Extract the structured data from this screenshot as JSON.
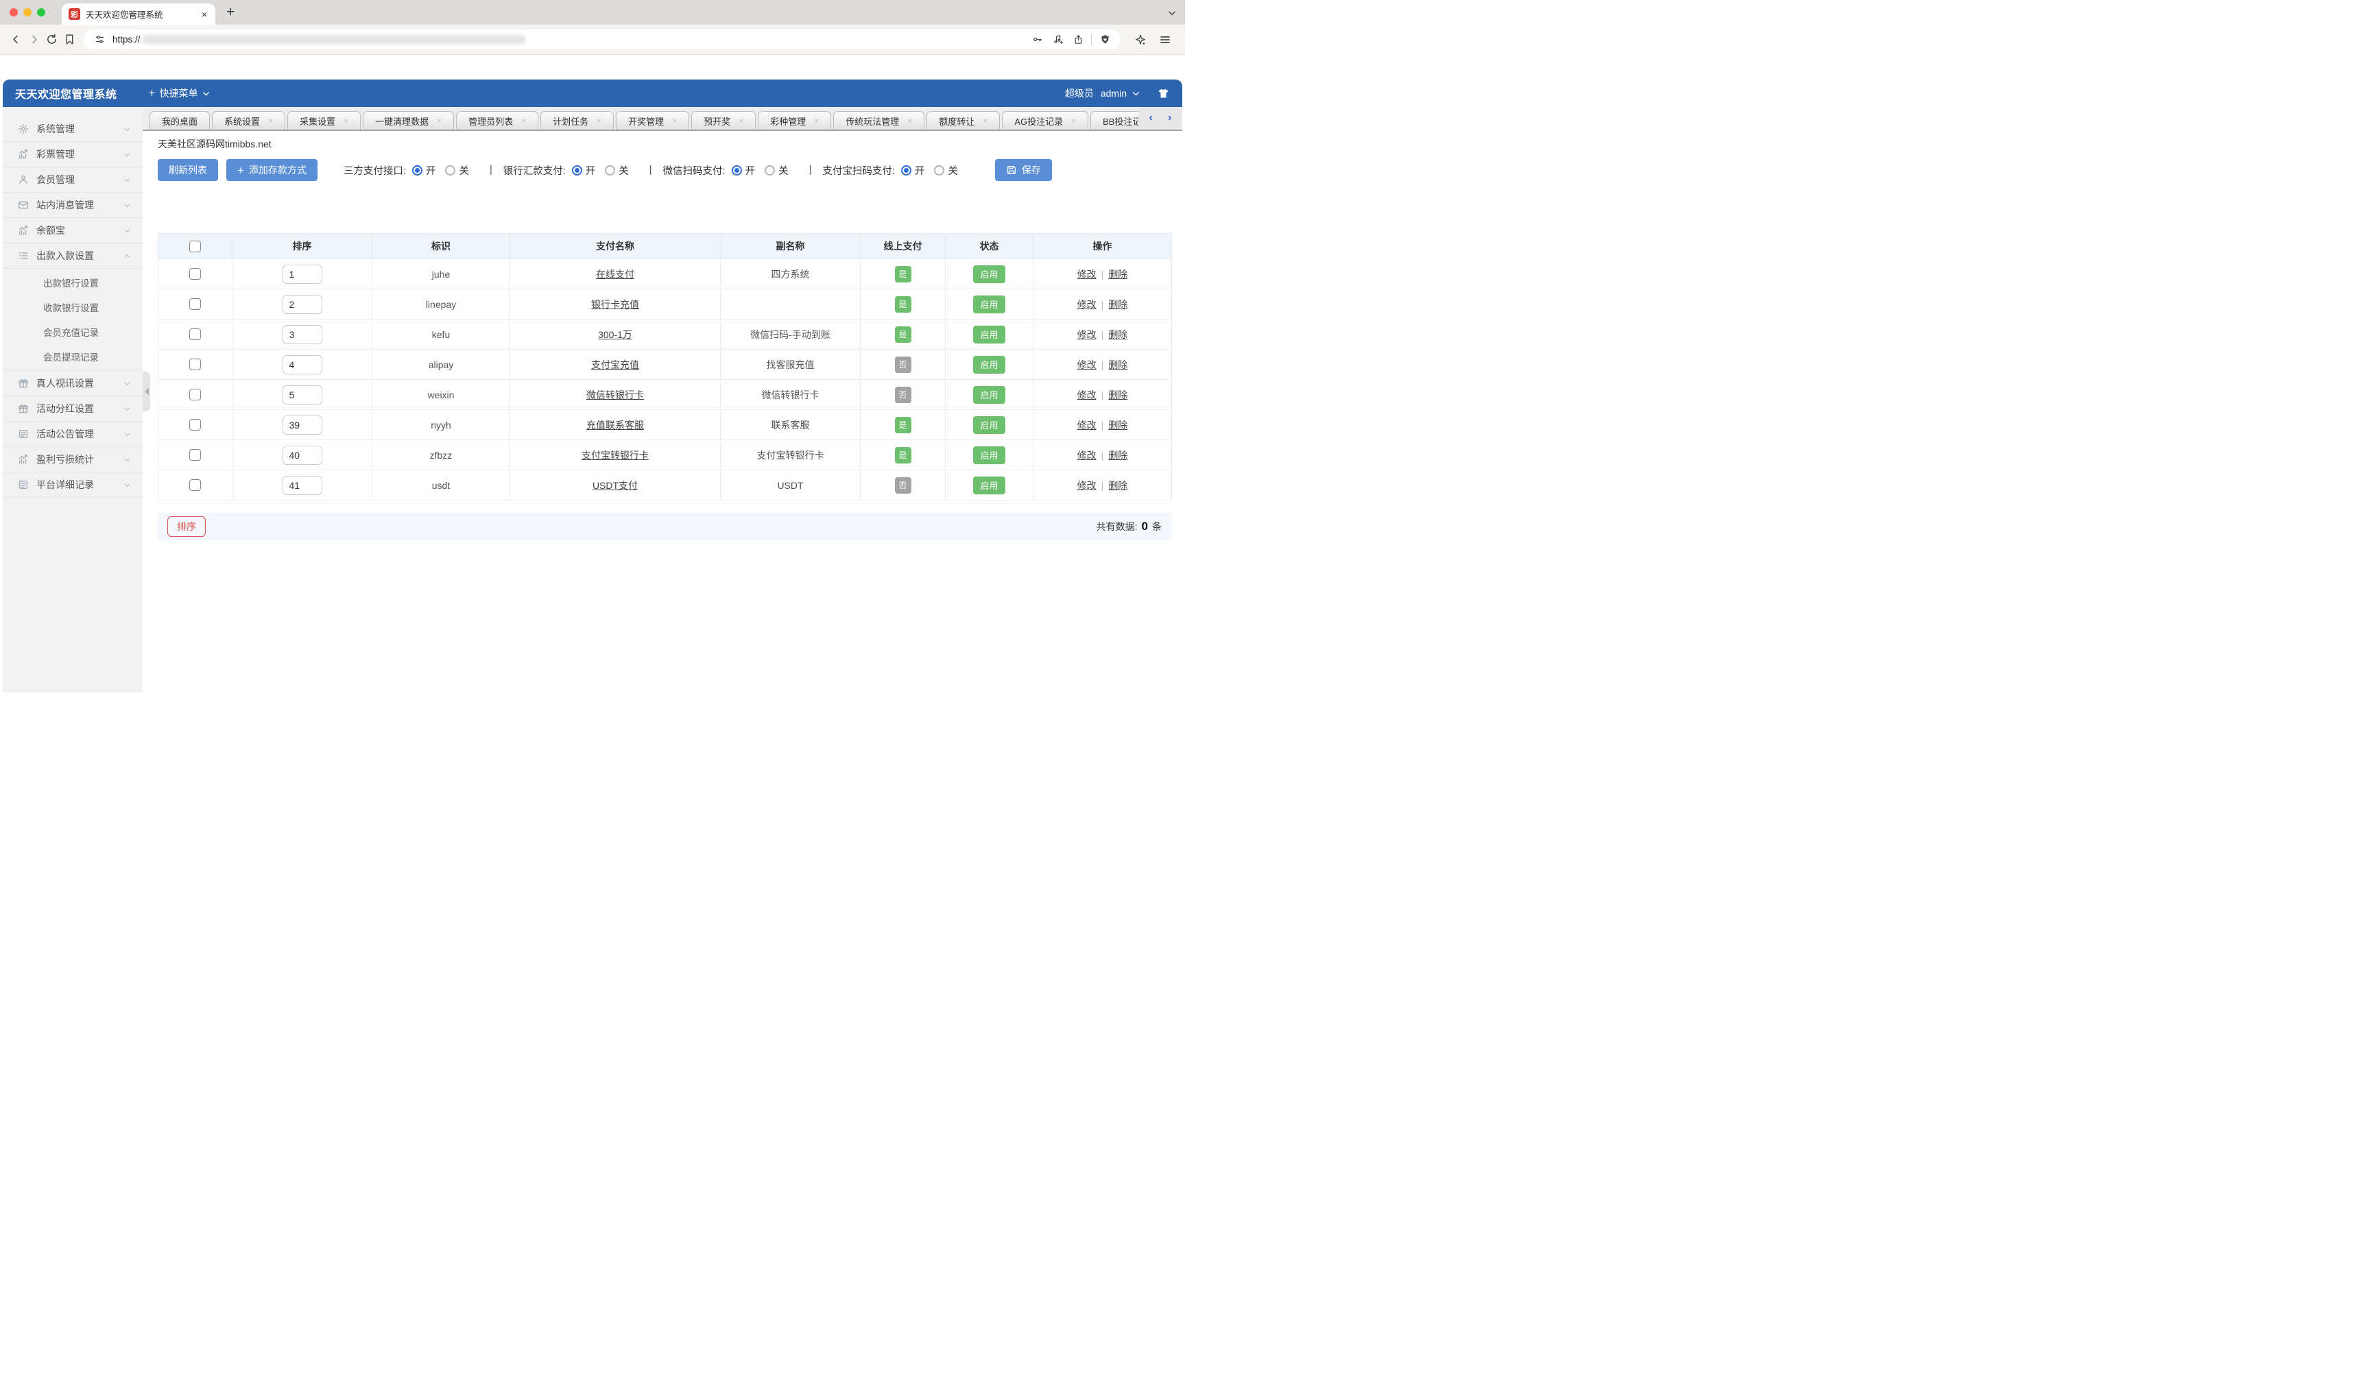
{
  "browser": {
    "tab": {
      "title": "天天欢迎您管理系统",
      "favicon_glyph": "彩",
      "close_icon": "×"
    },
    "new_tab_icon": "+",
    "url": {
      "scheme": "https://"
    }
  },
  "app_header": {
    "title": "天天欢迎您管理系统",
    "quick_menu_plus": "+",
    "quick_menu": "快捷菜单",
    "role": "超级员",
    "username": "admin"
  },
  "nav_tabs": [
    {
      "label": "我的桌面",
      "closable": false
    },
    {
      "label": "系统设置",
      "closable": true
    },
    {
      "label": "采集设置",
      "closable": true
    },
    {
      "label": "一键清理数据",
      "closable": true
    },
    {
      "label": "管理员列表",
      "closable": true
    },
    {
      "label": "计划任务",
      "closable": true
    },
    {
      "label": "开奖管理",
      "closable": true
    },
    {
      "label": "预开奖",
      "closable": true
    },
    {
      "label": "彩种管理",
      "closable": true
    },
    {
      "label": "传统玩法管理",
      "closable": true
    },
    {
      "label": "额度转让",
      "closable": true
    },
    {
      "label": "AG投注记录",
      "closable": true
    },
    {
      "label": "BB投注记录",
      "closable": true
    }
  ],
  "nav_tabs_scroll": {
    "left": "‹",
    "right": "›"
  },
  "breadcrumb": "天美社区源码网timibbs.net",
  "sidebar": [
    {
      "label": "系统管理",
      "icon": "gear"
    },
    {
      "label": "彩票管理",
      "icon": "chart"
    },
    {
      "label": "会员管理",
      "icon": "user"
    },
    {
      "label": "站内消息管理",
      "icon": "mail"
    },
    {
      "label": "余额宝",
      "icon": "chart"
    },
    {
      "label": "出款入款设置",
      "icon": "list",
      "expanded": true,
      "children": [
        "出款银行设置",
        "收款银行设置",
        "会员充值记录",
        "会员提现记录"
      ]
    },
    {
      "label": "真人视讯设置",
      "icon": "gift"
    },
    {
      "label": "活动分红设置",
      "icon": "gift"
    },
    {
      "label": "活动公告管理",
      "icon": "news"
    },
    {
      "label": "盈利亏损统计",
      "icon": "chart"
    },
    {
      "label": "平台详细记录",
      "icon": "news"
    }
  ],
  "controls": {
    "refresh": "刷新列表",
    "add_plus": "+",
    "add": "添加存款方式",
    "save": "保存",
    "toggle_separator": "|",
    "on_label": "开",
    "off_label": "关",
    "toggles": [
      {
        "label": "三方支付接口:",
        "selected": "on"
      },
      {
        "label": "银行汇款支付:",
        "selected": "on"
      },
      {
        "label": "微信扫码支付:",
        "selected": "on"
      },
      {
        "label": "支付宝扫码支付:",
        "selected": "on"
      }
    ]
  },
  "table": {
    "headers": [
      "排序",
      "标识",
      "支付名称",
      "副名称",
      "线上支付",
      "状态",
      "操作"
    ],
    "badge_yes": "是",
    "action_edit": "修改",
    "action_delete": "删除",
    "action_separator": "|",
    "rows": [
      {
        "sort": "1",
        "code": "juhe",
        "name": "在线支付",
        "subname": "四方系统",
        "online": "是",
        "status": "启用"
      },
      {
        "sort": "2",
        "code": "linepay",
        "name": "银行卡充值",
        "subname": "",
        "online": "是",
        "status": "启用"
      },
      {
        "sort": "3",
        "code": "kefu",
        "name": "300-1万",
        "subname": "微信扫码-手动到账",
        "online": "是",
        "status": "启用"
      },
      {
        "sort": "4",
        "code": "alipay",
        "name": "支付宝充值",
        "subname": "找客服充值",
        "online": "否",
        "status": "启用"
      },
      {
        "sort": "5",
        "code": "weixin",
        "name": "微信转银行卡",
        "subname": "微信转银行卡",
        "online": "否",
        "status": "启用"
      },
      {
        "sort": "39",
        "code": "nyyh",
        "name": "充值联系客服",
        "subname": "联系客服",
        "online": "是",
        "status": "启用"
      },
      {
        "sort": "40",
        "code": "zfbzz",
        "name": "支付宝转银行卡",
        "subname": "支付宝转银行卡",
        "online": "是",
        "status": "启用"
      },
      {
        "sort": "41",
        "code": "usdt",
        "name": "USDT支付",
        "subname": "USDT",
        "online": "否",
        "status": "启用"
      }
    ]
  },
  "footer": {
    "sort_button": "排序",
    "total_label": "共有数据:",
    "total_value": "0",
    "total_unit": "条"
  },
  "colors": {
    "header_blue": "#2d64b0",
    "button_blue": "#5a8ed6",
    "badge_green": "#6cbf6c",
    "badge_gray": "#a3a3a3",
    "danger_red": "#d9534f",
    "favicon_red": "#d93a30",
    "brave_orange": "#f55a22"
  }
}
